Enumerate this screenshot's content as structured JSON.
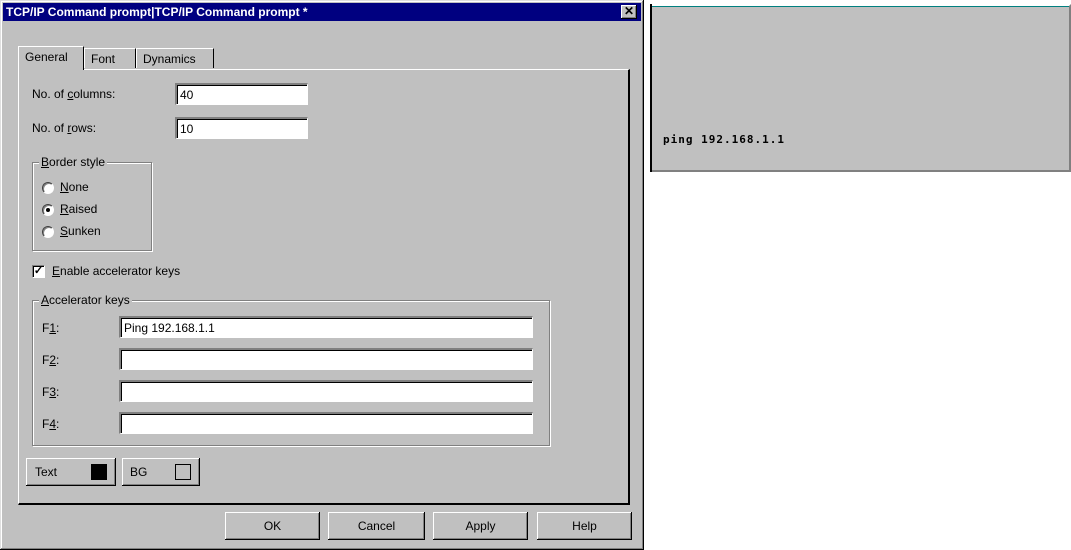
{
  "dialog": {
    "title": "TCP/IP Command prompt|TCP/IP Command prompt *",
    "close_glyph": "✕"
  },
  "tabs": [
    "General",
    "Font",
    "Dynamics"
  ],
  "general": {
    "columns_label_pre": "No. of ",
    "columns_label_key": "c",
    "columns_label_post": "olumns:",
    "columns_value": "40",
    "rows_label_pre": "No. of ",
    "rows_label_key": "r",
    "rows_label_post": "ows:",
    "rows_value": "10",
    "border_style": {
      "legend_key": "B",
      "legend_rest": "order style",
      "options": [
        {
          "key": "N",
          "rest": "one",
          "selected": false
        },
        {
          "key": "R",
          "rest": "aised",
          "selected": true
        },
        {
          "key": "S",
          "rest": "unken",
          "selected": false
        }
      ]
    },
    "enable_accel": {
      "key": "E",
      "rest": "nable accelerator keys",
      "checked": true
    },
    "accel_keys": {
      "legend_key": "A",
      "legend_rest": "ccelerator keys",
      "rows": [
        {
          "pre": "F",
          "key": "1",
          "value": "Ping 192.168.1.1"
        },
        {
          "pre": "F",
          "key": "2",
          "value": ""
        },
        {
          "pre": "F",
          "key": "3",
          "value": ""
        },
        {
          "pre": "F",
          "key": "4",
          "value": ""
        }
      ]
    },
    "text_button": "Text",
    "bg_button": "BG",
    "text_color": "#000000",
    "bg_color": "#c0c0c0"
  },
  "buttons": {
    "ok": "OK",
    "cancel": "Cancel",
    "apply": "Apply",
    "help": "Help"
  },
  "preview": {
    "text": "ping 192.168.1.1"
  }
}
